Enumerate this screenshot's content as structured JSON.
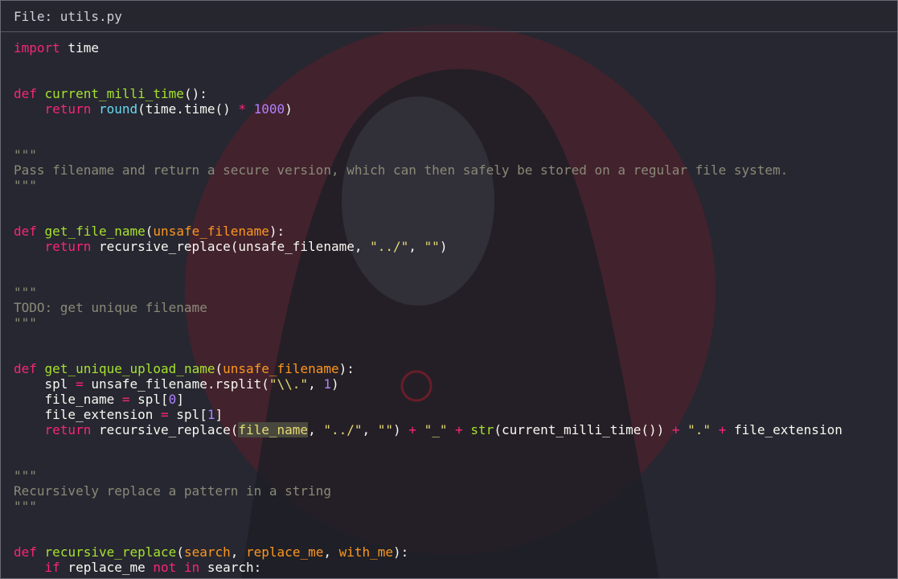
{
  "title": "File: utils.py",
  "code": {
    "l1": {
      "kw": "import",
      "rest": " time"
    },
    "l4": {
      "kw": "def",
      "sp": " ",
      "fn": "current_milli_time",
      "tail": "():"
    },
    "l5": {
      "indent": "    ",
      "kw": "return",
      "sp": " ",
      "bi": "round",
      "mid": "(time.time() ",
      "op": "*",
      "sp2": " ",
      "num": "1000",
      "tail": ")"
    },
    "l8": "\"\"\"",
    "l9": "Pass filename and return a secure version, which can then safely be stored on a regular file system.",
    "l10": "\"\"\"",
    "l13": {
      "kw": "def",
      "sp": " ",
      "fn": "get_file_name",
      "p1": "(",
      "param": "unsafe_filename",
      "tail": "):"
    },
    "l14": {
      "indent": "    ",
      "kw": "return",
      "mid": " recursive_replace(unsafe_filename, ",
      "s1": "\"../\"",
      "c": ", ",
      "s2": "\"\"",
      "tail": ")"
    },
    "l17": "\"\"\"",
    "l18": "TODO: get unique filename",
    "l19": "\"\"\"",
    "l22": {
      "kw": "def",
      "sp": " ",
      "fn": "get_unique_upload_name",
      "p1": "(",
      "param": "unsafe_filename",
      "tail": "):"
    },
    "l23": {
      "a": "    spl ",
      "op": "=",
      "b": " unsafe_filename.rsplit(",
      "s": "\"\\\\.\"",
      "c": ", ",
      "num": "1",
      "tail": ")"
    },
    "l24": {
      "a": "    file_name ",
      "op": "=",
      "b": " spl[",
      "num": "0",
      "tail": "]"
    },
    "l25": {
      "a": "    file_extension ",
      "op": "=",
      "b": " spl[",
      "num": "1",
      "tail": "]"
    },
    "l26": {
      "indent": "    ",
      "kw": "return",
      "a": " recursive_replace(",
      "hl": "file_name",
      "c1": ", ",
      "s1": "\"../\"",
      "c2": ", ",
      "s2": "\"\"",
      "b": ") ",
      "op1": "+",
      "sp1": " ",
      "s3": "\"_\"",
      "sp2": " ",
      "op2": "+",
      "sp3": " ",
      "bi": "str",
      "m": "(current_milli_time()) ",
      "op3": "+",
      "sp4": " ",
      "s4": "\".\"",
      "sp5": " ",
      "op4": "+",
      "tail": " file_extension"
    },
    "l29": "\"\"\"",
    "l30": "Recursively replace a pattern in a string",
    "l31": "\"\"\"",
    "l34": {
      "kw": "def",
      "sp": " ",
      "fn": "recursive_replace",
      "p1": "(",
      "pa": "search",
      "c1": ", ",
      "pb": "replace_me",
      "c2": ", ",
      "pc": "with_me",
      "tail": "):"
    },
    "l35": {
      "indent": "    ",
      "kw": "if",
      "a": " replace_me ",
      "kw2": "not",
      "sp": " ",
      "kw3": "in",
      "tail": " search:"
    }
  },
  "colors": {
    "background": "#272731",
    "keyword": "#f92672",
    "function": "#a6e22e",
    "builtin": "#66d9ef",
    "number": "#ae81ff",
    "parameter": "#fd971f",
    "string": "#e6db74",
    "comment": "#8a8a78",
    "wallpaper_accent": "#7a1d2a"
  }
}
